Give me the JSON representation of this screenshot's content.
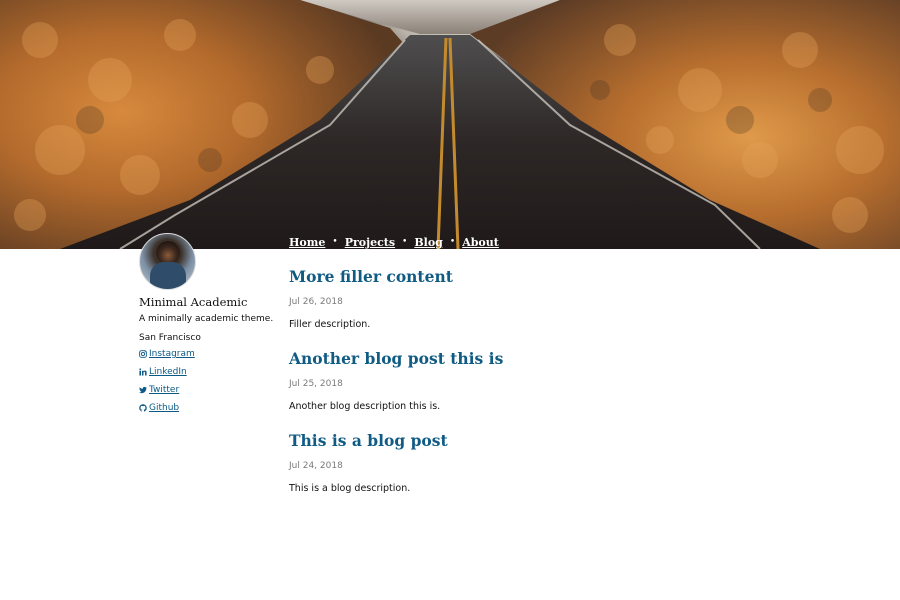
{
  "nav": {
    "items": [
      {
        "label": "Home"
      },
      {
        "label": "Projects"
      },
      {
        "label": "Blog"
      },
      {
        "label": "About"
      }
    ],
    "separator": "•"
  },
  "sidebar": {
    "name": "Minimal Academic",
    "tagline": "A minimally academic theme.",
    "location": "San Francisco",
    "links": [
      {
        "label": " Instagram",
        "icon": "instagram-icon"
      },
      {
        "label": " LinkedIn",
        "icon": "linkedin-icon"
      },
      {
        "label": " Twitter",
        "icon": "twitter-icon"
      },
      {
        "label": " Github",
        "icon": "github-icon"
      }
    ]
  },
  "posts": [
    {
      "title": "More filler content",
      "date": "Jul 26, 2018",
      "description": "Filler description."
    },
    {
      "title": "Another blog post this is",
      "date": "Jul 25, 2018",
      "description": "Another blog description this is."
    },
    {
      "title": "This is a blog post",
      "date": "Jul 24, 2018",
      "description": "This is a blog description."
    }
  ],
  "colors": {
    "link": "#0c5a85",
    "title": "#0f5b84",
    "date": "#7a7a7a",
    "hero_brush": "#c9772f"
  }
}
